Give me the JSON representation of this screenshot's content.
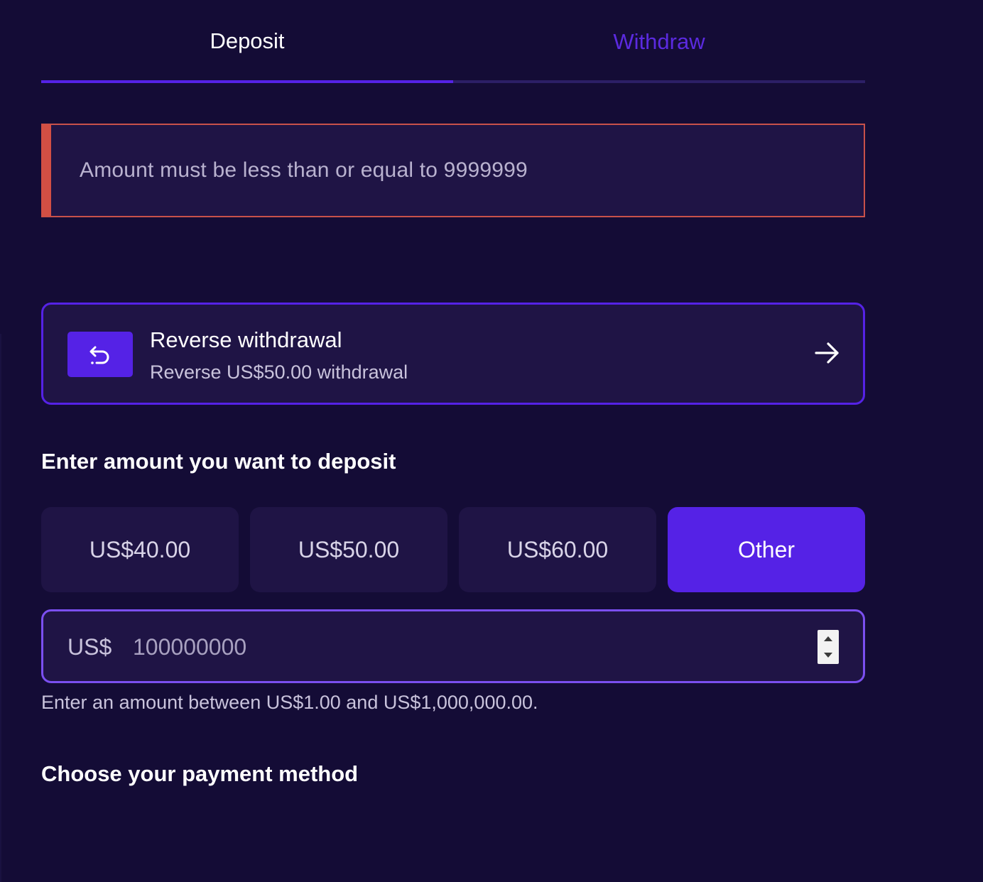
{
  "tabs": {
    "deposit_label": "Deposit",
    "withdraw_label": "Withdraw",
    "active": "Deposit"
  },
  "error": {
    "message": "Amount must be less than or equal to 9999999"
  },
  "reverse_withdrawal": {
    "icon": "undo-arrow-icon",
    "title": "Reverse withdrawal",
    "subtitle": "Reverse US$50.00 withdrawal",
    "action_icon": "arrow-right-icon"
  },
  "amount_section": {
    "heading": "Enter amount you want to deposit",
    "options": [
      "US$40.00",
      "US$50.00",
      "US$60.00",
      "Other"
    ],
    "selected": "Other",
    "currency_prefix": "US$",
    "input_value": "100000000",
    "hint": "Enter an amount between US$1.00 and US$1,000,000.00."
  },
  "payment_section": {
    "heading": "Choose your payment method"
  },
  "colors": {
    "background": "#140c36",
    "card": "#1f1445",
    "accent": "#5522e6",
    "error": "#d24f44"
  }
}
